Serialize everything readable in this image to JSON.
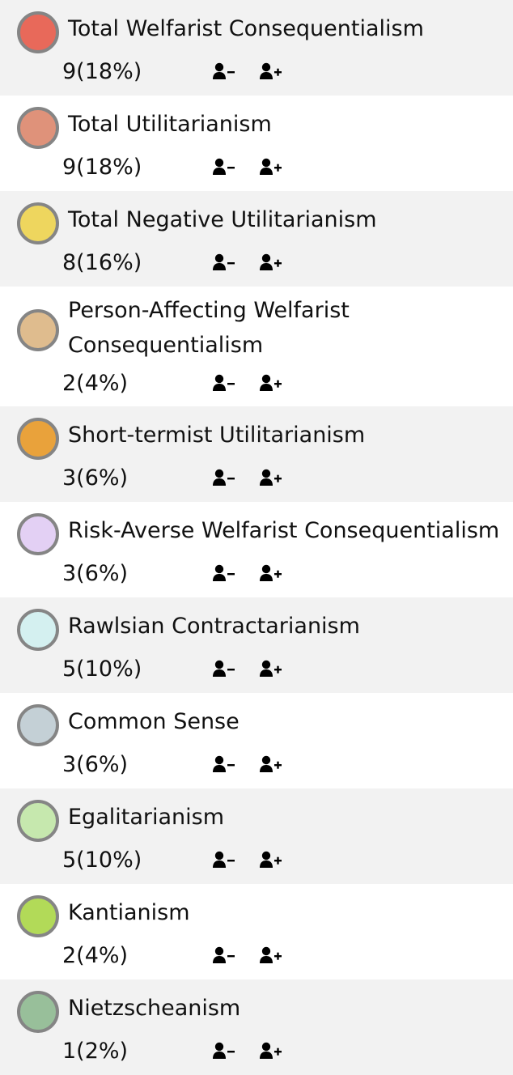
{
  "items": [
    {
      "name": "Total Welfarist Consequentialism",
      "count": "9(18%)",
      "color": "#e8695a"
    },
    {
      "name": "Total Utilitarianism",
      "count": "9(18%)",
      "color": "#df927a"
    },
    {
      "name": "Total Negative Utilitarianism",
      "count": "8(16%)",
      "color": "#eed65e"
    },
    {
      "name": "Person-Affecting Welfarist Consequentialism",
      "count": "2(4%)",
      "color": "#dfbc8e"
    },
    {
      "name": "Short-termist Utilitarianism",
      "count": "3(6%)",
      "color": "#e9a23b"
    },
    {
      "name": "Risk-Averse Welfarist Consequentialism",
      "count": "3(6%)",
      "color": "#e3d0f4"
    },
    {
      "name": "Rawlsian Contractarianism",
      "count": "5(10%)",
      "color": "#d4f0f0"
    },
    {
      "name": "Common Sense",
      "count": "3(6%)",
      "color": "#c4d0d6"
    },
    {
      "name": "Egalitarianism",
      "count": "5(10%)",
      "color": "#c6e8ae"
    },
    {
      "name": "Kantianism",
      "count": "2(4%)",
      "color": "#b2da58"
    },
    {
      "name": "Nietzscheanism",
      "count": "1(2%)",
      "color": "#98bf9a"
    }
  ],
  "icons": {
    "remove": "user-minus-icon",
    "add": "user-plus-icon"
  }
}
